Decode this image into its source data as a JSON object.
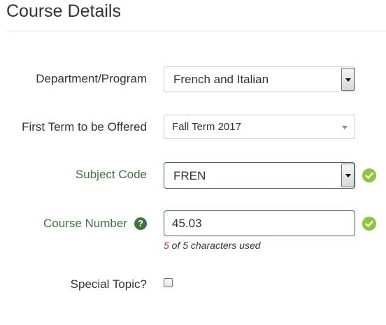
{
  "page": {
    "title": "Course Details"
  },
  "form": {
    "department": {
      "label": "Department/Program",
      "value": "French and Italian"
    },
    "first_term": {
      "label": "First Term to be Offered",
      "value": "Fall Term 2017"
    },
    "subject_code": {
      "label": "Subject Code",
      "value": "FREN",
      "status": "valid"
    },
    "course_number": {
      "label": "Course Number",
      "value": "45.03",
      "help_glyph": "?",
      "status": "valid",
      "char_count": {
        "used": "5",
        "suffix": " of 5 characters used"
      }
    },
    "special_topic": {
      "label": "Special Topic?",
      "checked": false
    }
  },
  "icons": {
    "help": "question-circle-icon",
    "valid": "check-circle-icon"
  },
  "colors": {
    "valid_text": "#3c763d",
    "valid_check": "#8cc63f",
    "count_used": "#c9302c"
  }
}
